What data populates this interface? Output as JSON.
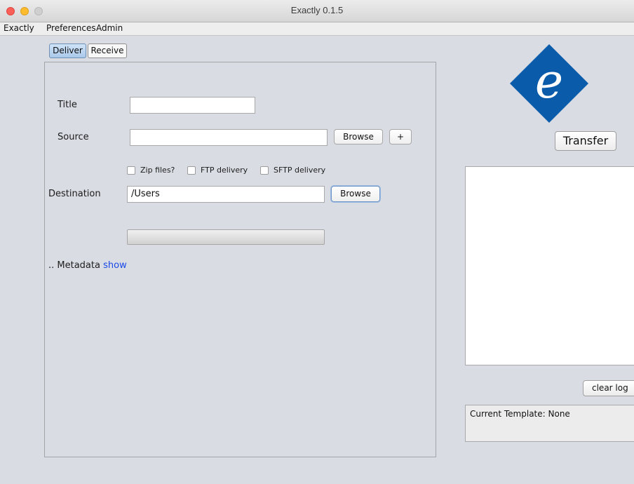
{
  "window": {
    "title": "Exactly 0.1.5"
  },
  "menu": [
    "Exactly",
    "Preferences",
    "Admin"
  ],
  "tabs": [
    {
      "label": "Deliver",
      "active": true
    },
    {
      "label": "Receive",
      "active": false
    }
  ],
  "form": {
    "title_label": "Title",
    "title_value": "",
    "source_label": "Source",
    "source_value": "",
    "browse_label": "Browse",
    "add_label": "+",
    "options": [
      {
        "label": "Zip files?",
        "checked": false
      },
      {
        "label": "FTP delivery",
        "checked": false
      },
      {
        "label": "SFTP delivery",
        "checked": false
      }
    ],
    "destination_label": "Destination",
    "destination_value": "/Users",
    "destination_browse_label": "Browse",
    "progress": 0,
    "metadata_prefix": ".. Metadata",
    "metadata_link": "show"
  },
  "right": {
    "logo_letter": "e",
    "logo_color": "#0a5cab",
    "transfer_label": "Transfer",
    "log_text": "",
    "clear_log_label": "clear log",
    "template_text": "Current Template: None"
  }
}
